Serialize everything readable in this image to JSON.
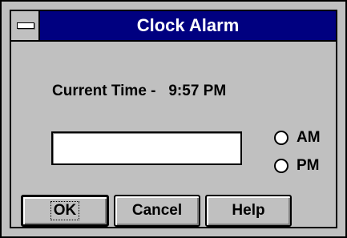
{
  "window": {
    "title": "Clock Alarm",
    "system_menu_icon": "system-menu-icon"
  },
  "current_time": {
    "label": "Current Time -",
    "value": "9:57 PM"
  },
  "alarm_input": {
    "value": ""
  },
  "period_options": [
    {
      "label": "AM",
      "selected": false
    },
    {
      "label": "PM",
      "selected": false
    }
  ],
  "buttons": {
    "ok_label": "OK",
    "cancel_label": "Cancel",
    "help_label": "Help"
  },
  "colors": {
    "title_bar": "#000080",
    "face": "#c0c0c0",
    "title_text": "#ffffff"
  }
}
